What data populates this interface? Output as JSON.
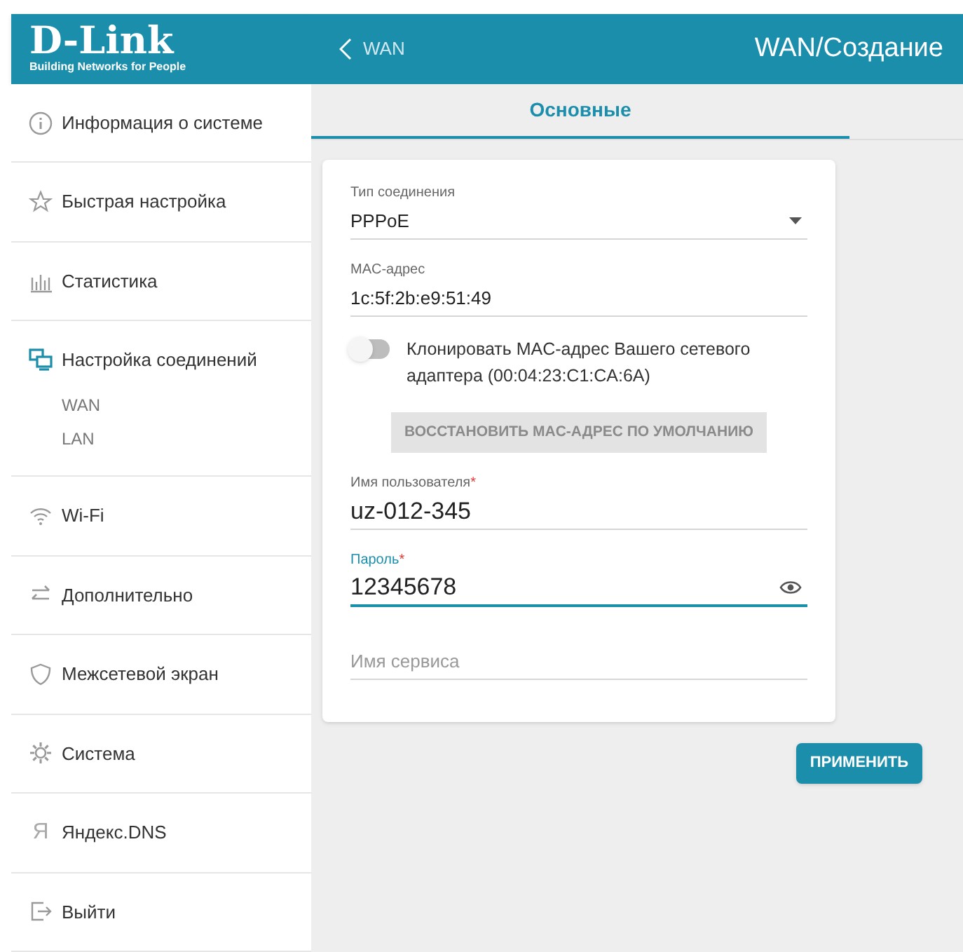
{
  "logo": {
    "title": "D-Link",
    "tagline": "Building Networks for People"
  },
  "header": {
    "back_label": "WAN",
    "title": "WAN/Создание"
  },
  "tabs": [
    {
      "label": "Основные",
      "selected": true
    }
  ],
  "sidebar": {
    "items": [
      {
        "label": "Информация о системе"
      },
      {
        "label": "Быстрая настройка"
      },
      {
        "label": "Статистика"
      },
      {
        "label": "Настройка соединений",
        "children": [
          {
            "label": "WAN"
          },
          {
            "label": "LAN"
          }
        ]
      },
      {
        "label": "Wi-Fi"
      },
      {
        "label": "Дополнительно"
      },
      {
        "label": "Межсетевой экран"
      },
      {
        "label": "Система"
      },
      {
        "label": "Яндекс.DNS",
        "icon_text": "Я"
      },
      {
        "label": "Выйти"
      }
    ]
  },
  "form": {
    "fields": [
      {
        "kind": "select",
        "label": "Тип соединения",
        "value": "PPPoE"
      },
      {
        "kind": "text",
        "label": "MAC-адрес",
        "value": "1c:5f:2b:e9:51:49"
      },
      {
        "kind": "toggle",
        "label": "Клонировать MAC-адрес Вашего сетевого адаптера (00:04:23:C1:CA:6A)",
        "on": false
      },
      {
        "kind": "button",
        "label": "ВОССТАНОВИТЬ MAC-АДРЕС ПО УМОЛЧАНИЮ",
        "disabled": true
      },
      {
        "kind": "text",
        "label": "Имя пользователя",
        "required_mark": "*",
        "value": "uz-012-345",
        "focused": false
      },
      {
        "kind": "password",
        "label": "Пароль",
        "required_mark": "*",
        "value": "12345678",
        "focused": true
      },
      {
        "kind": "text",
        "placeholder": "Имя сервиса",
        "focused": false
      }
    ]
  },
  "apply_button": {
    "label": "ПРИМЕНИТЬ"
  }
}
